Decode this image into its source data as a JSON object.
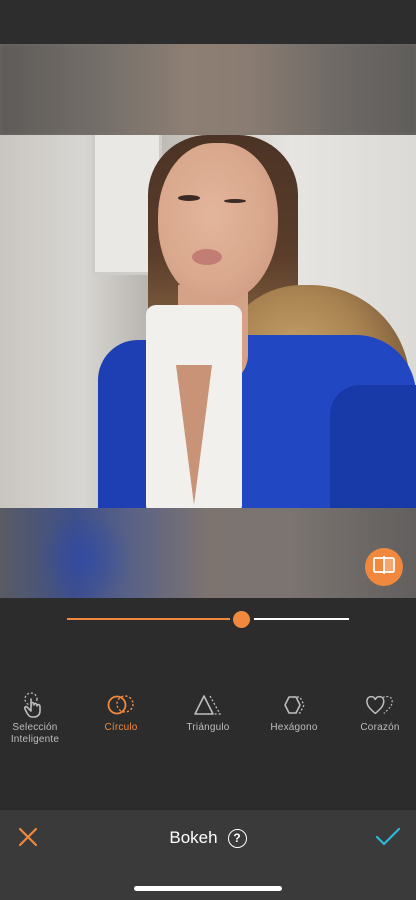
{
  "editor": {
    "title": "Bokeh",
    "slider_value_fraction": 0.62
  },
  "shape_tools": [
    {
      "label_line1": "Selección",
      "label_line2": "Inteligente",
      "icon": "smart-select-hand-icon",
      "active": false
    },
    {
      "label_line1": "Círculo",
      "label_line2": "",
      "icon": "circle-shapes-icon",
      "active": true
    },
    {
      "label_line1": "Triángulo",
      "label_line2": "",
      "icon": "triangle-shapes-icon",
      "active": false
    },
    {
      "label_line1": "Hexágono",
      "label_line2": "",
      "icon": "hexagon-shapes-icon",
      "active": false
    },
    {
      "label_line1": "Corazón",
      "label_line2": "",
      "icon": "heart-shapes-icon",
      "active": false
    }
  ],
  "colors": {
    "accent": "#f0893e",
    "confirm": "#2fb7d8",
    "toolbar_bg": "#2c2c2c",
    "bottom_bar_bg": "#3a3a3a"
  },
  "icons": {
    "compare": "compare-split-icon",
    "close": "close-x-icon",
    "confirm": "checkmark-icon",
    "help": "help-question-icon"
  },
  "help_glyph": "?"
}
